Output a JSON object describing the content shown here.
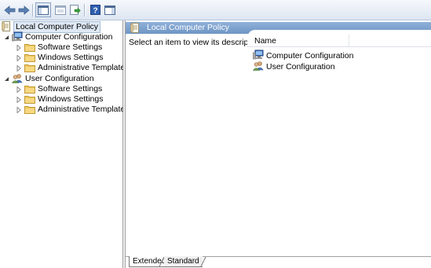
{
  "toolbar": {
    "buttons": [
      {
        "name": "back-arrow-icon"
      },
      {
        "name": "forward-arrow-icon"
      },
      {
        "name": "show-hide-tree-icon"
      },
      {
        "name": "properties-icon"
      },
      {
        "name": "export-list-icon"
      },
      {
        "name": "help-icon"
      },
      {
        "name": "show-hide-action-pane-icon"
      }
    ]
  },
  "tree": {
    "root": "Local Computer Policy",
    "computer_configuration": "Computer Configuration",
    "cc_software_settings": "Software Settings",
    "cc_windows_settings": "Windows Settings",
    "cc_admin_templates": "Administrative Templates",
    "user_configuration": "User Configuration",
    "uc_software_settings": "Software Settings",
    "uc_windows_settings": "Windows Settings",
    "uc_admin_templates": "Administrative Templates"
  },
  "details": {
    "header_title": "Local Computer Policy",
    "description": "Select an item to view its description.",
    "column_name": "Name",
    "items": [
      "Computer Configuration",
      "User Configuration"
    ]
  },
  "tabs": {
    "extended": "Extended",
    "standard": "Standard"
  },
  "colors": {
    "header_gradient_top": "#8fb1d9",
    "header_gradient_bottom": "#6f95c4",
    "folder": "#f0c75e",
    "selection": "#dfe9f5"
  }
}
